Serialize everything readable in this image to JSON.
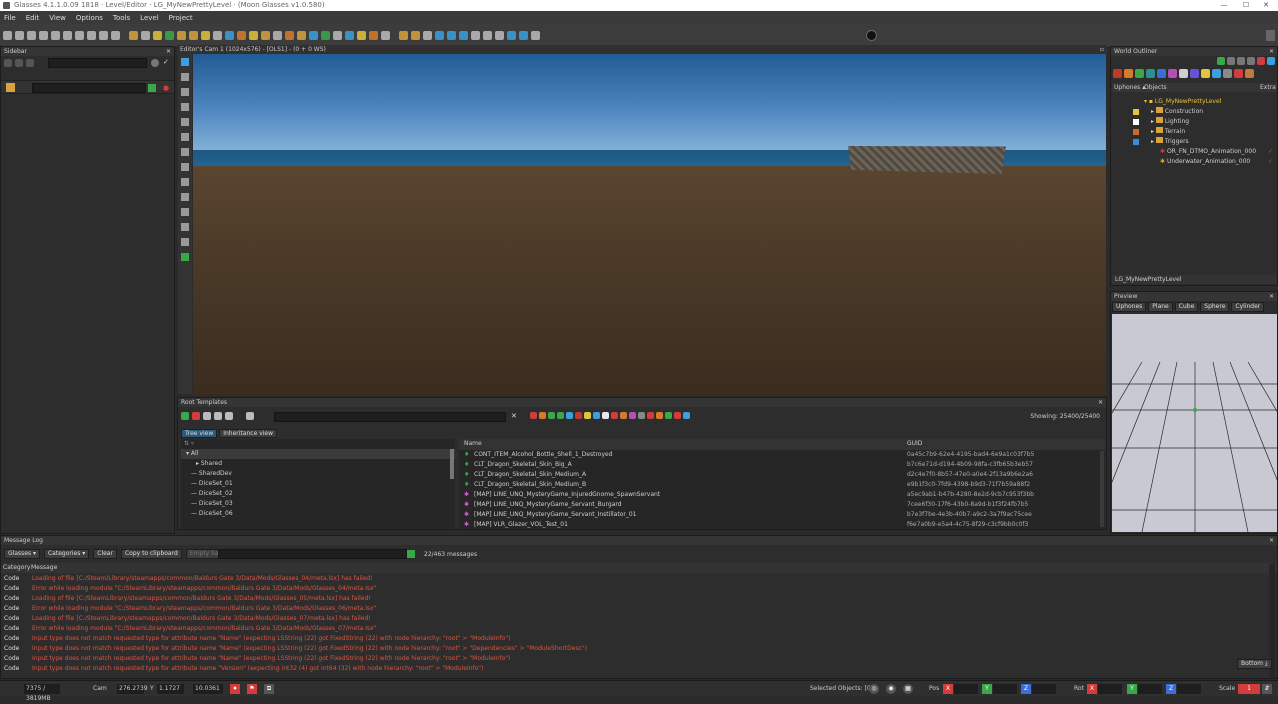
{
  "window": {
    "title": "Glasses 4.1.1.0.09 1818 · Level/Editor · LG_MyNewPrettyLevel · (Moon Glasses v1.0.580)",
    "minimize": "—",
    "maximize": "☐",
    "close": "✕"
  },
  "menu": [
    "File",
    "Edit",
    "View",
    "Options",
    "Tools",
    "Level",
    "Project"
  ],
  "sidebar": {
    "title": "Sidebar"
  },
  "viewport": {
    "title": "Editor's Cam 1 (1024x576) - [OLS1] - (0 + 0 WS)"
  },
  "world_outliner": {
    "title": "World Outliner",
    "tabs": [
      "Uphones ▴",
      "Objects",
      "Extra"
    ],
    "root": "LG_MyNewPrettyLevel",
    "folders": [
      "Construction",
      "Lighting",
      "Terrain",
      "Triggers"
    ],
    "items": [
      "OR_FN_DTMO_Animation_000",
      "Underwater_Animation_000"
    ],
    "footer": "LG_MyNewPrettyLevel"
  },
  "preview": {
    "title": "Preview",
    "tabs": [
      "Uphones",
      "Plane",
      "Cube",
      "Sphere",
      "Cylinder"
    ]
  },
  "root_templates": {
    "title": "Root Templates",
    "showing": "Showing: 25400/25400",
    "views": [
      "Tree view",
      "Inheritance view"
    ],
    "tree": [
      "All",
      "Shared",
      "SharedDev",
      "DiceSet_01",
      "DiceSet_02",
      "DiceSet_03",
      "DiceSet_06"
    ],
    "columns": [
      "Name",
      "GUID"
    ],
    "rows": [
      {
        "name": "CONT_ITEM_Alcohol_Bottle_Shell_1_Destroyed",
        "guid": "0a45c7b9-62e4-4195-bad4-6e9a1c03f7b5"
      },
      {
        "name": "CLT_Dragon_Skeletal_Skin_Big_A",
        "guid": "b7c6e71d-d194-4b09-98fa-c3fb65b3eb57"
      },
      {
        "name": "CLT_Dragon_Skeletal_Skin_Medium_A",
        "guid": "d2c4e7f0-8b57-47e0-a0e4-2f13a9b6e2a6"
      },
      {
        "name": "CLT_Dragon_Skeletal_Skin_Medium_B",
        "guid": "e9b1f3c0-7fd9-4398-b9d3-71f7b59a88f2"
      },
      {
        "name": "[MAP] LINE_UNQ_MysteryGame_InjuredGnome_SpawnServant",
        "guid": "a5ec9ab1-b47b-4280-8e2d-9cb7c953f3bb"
      },
      {
        "name": "[MAP] LINE_UNQ_MysteryGame_Servant_Burgard",
        "guid": "7cee6f30-17f6-43b0-8a9d-b1f3f24fb7b5"
      },
      {
        "name": "[MAP] LINE_UNQ_MysteryGame_Servant_Instillator_01",
        "guid": "b7e3f7be-4e3b-40b7-a9c2-3a7f9ac75cee"
      },
      {
        "name": "[MAP] VLR_Glazer_VOL_Test_01",
        "guid": "f6e7a0b9-e5a4-4c75-8f29-c3cf9bb0c0f3"
      }
    ]
  },
  "message_log": {
    "title": "Message Log",
    "filters": [
      "Glasses ▾",
      "Categories ▾"
    ],
    "buttons": [
      "Clear",
      "Copy to clipboard",
      "Empty Save"
    ],
    "count": "22/463 messages",
    "columns": [
      "Category",
      "Message"
    ],
    "bottom_btn": "Bottom ⤓",
    "lines": [
      {
        "cat": "Code",
        "msg": "Loading of file [C:/Steam/Library/steamapps/common/Baldurs Gate 3/Data/Mods/Glasses_04/meta.lsx] has failed!"
      },
      {
        "cat": "Code",
        "msg": "Error while loading module \"C:/SteamLibrary/steamapps/common/Baldurs Gate 3/Data/Mods/Glasses_04/meta.lsx\""
      },
      {
        "cat": "Code",
        "msg": "Loading of file [C:/SteamLibrary/steamapps/common/Baldurs Gate 3/Data/Mods/Glasses_05/meta.lsx] has failed!"
      },
      {
        "cat": "Code",
        "msg": "Error while loading module \"C:/SteamLibrary/steamapps/common/Baldurs Gate 3/Data/Mods/Glasses_06/meta.lsx\""
      },
      {
        "cat": "Code",
        "msg": "Loading of file [C:/SteamLibrary/steamapps/common/Baldurs Gate 3/Data/Mods/Glasses_07/meta.lsx] has failed!"
      },
      {
        "cat": "Code",
        "msg": "Error while loading module \"C:/SteamLibrary/steamapps/common/Baldurs Gate 3/Data/Mods/Glasses_07/meta.lsx\""
      },
      {
        "cat": "Code",
        "msg": "Input type does not match requested type for attribute name \"Name\" (expecting LSString (22) got FixedString (22) with node hierarchy: \"root\" > \"ModuleInfo\")"
      },
      {
        "cat": "Code",
        "msg": "Input type does not match requested type for attribute name \"Name\" (expecting LSString (22) got FixedString (22) with node hierarchy: \"root\" > \"Dependencies\" > \"ModuleShortDesc\")"
      },
      {
        "cat": "Code",
        "msg": "Input type does not match requested type for attribute name \"Name\" (expecting LSString (22) got FixedString (22) with node hierarchy: \"root\" > \"ModuleInfo\")"
      },
      {
        "cat": "Code",
        "msg": "Input type does not match requested type for attribute name \"Version\" (expecting int32 (4) got int64 (32) with node hierarchy: \"root\" > \"ModuleInfo\")"
      }
    ]
  },
  "status": {
    "fps": "7375 / 3819MB",
    "cam_label": "Cam",
    "cam_x": "276.2739",
    "cam_y_label": "Y",
    "cam_y": "1.1727",
    "cam_z": "10.0361",
    "selected": "Selected Objects: [0]",
    "pos_label": "Pos",
    "rot_label": "Rot",
    "scale_label": "Scale",
    "x": "X",
    "y": "Y",
    "z": "Z",
    "scale_val": "1"
  },
  "colors": {
    "accent": "#3aa0e0",
    "error": "#e0533d",
    "folder": "#d8a23c",
    "red": "#d23c3c",
    "green": "#3aa84a"
  }
}
